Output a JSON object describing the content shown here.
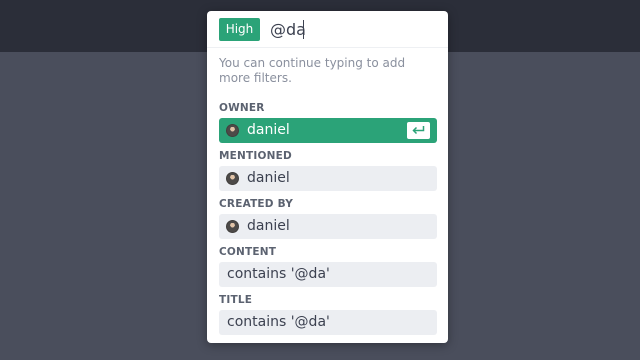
{
  "filter_popup": {
    "priority_tag": "High",
    "search_value": "@da",
    "hint": "You can continue typing to add more filters.",
    "sections": [
      {
        "label": "OWNER",
        "value": "daniel"
      },
      {
        "label": "MENTIONED",
        "value": "daniel"
      },
      {
        "label": "CREATED BY",
        "value": "daniel"
      },
      {
        "label": "CONTENT",
        "value": "contains '@da'"
      },
      {
        "label": "TITLE",
        "value": "contains '@da'"
      }
    ],
    "icons": {
      "enter_key": "enter-key-icon",
      "avatar": "user-avatar"
    }
  },
  "colors": {
    "accent": "#2ba378",
    "background": "#4a4e5c",
    "header": "#2b2e39"
  }
}
